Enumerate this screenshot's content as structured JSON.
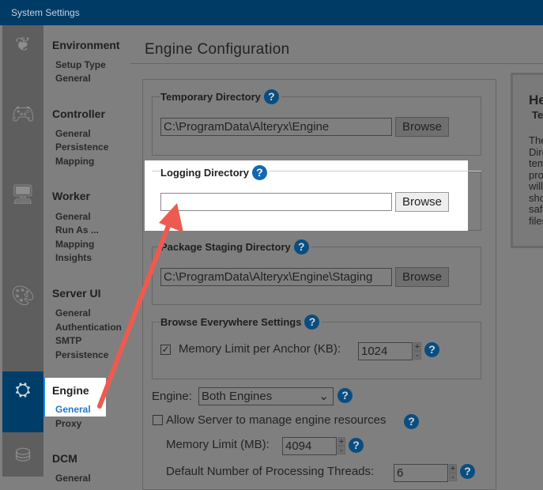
{
  "window": {
    "title": "System Settings"
  },
  "nav": {
    "sections": [
      {
        "title": "Environment",
        "items": [
          "Setup Type",
          "General"
        ]
      },
      {
        "title": "Controller",
        "items": [
          "General",
          "Persistence",
          "Mapping"
        ]
      },
      {
        "title": "Worker",
        "items": [
          "General",
          "Run As ...",
          "Mapping",
          "Insights"
        ]
      },
      {
        "title": "Server UI",
        "items": [
          "General",
          "Authentication",
          "SMTP",
          "Persistence"
        ]
      },
      {
        "title": "Engine",
        "items": [
          "General",
          "Proxy"
        ]
      },
      {
        "title": "DCM",
        "items": [
          "General"
        ]
      }
    ]
  },
  "main": {
    "title": "Engine Configuration",
    "temp_dir": {
      "label": "Temporary Directory",
      "value": "C:\\ProgramData\\Alteryx\\Engine",
      "browse": "Browse"
    },
    "log_dir": {
      "label": "Logging Directory",
      "value": "",
      "browse": "Browse"
    },
    "staging_dir": {
      "label": "Package Staging Directory",
      "value": "C:\\ProgramData\\Alteryx\\Engine\\Staging",
      "browse": "Browse"
    },
    "browse_everywhere": {
      "label": "Browse Everywhere Settings",
      "mem_label": "Memory Limit per Anchor (KB):",
      "mem_value": "1024",
      "checked": true
    },
    "engine": {
      "label": "Engine:",
      "value": "Both Engines"
    },
    "allow_manage": {
      "label": "Allow Server to manage engine resources",
      "checked": false
    },
    "mem_limit": {
      "label": "Memory Limit (MB):",
      "value": "4094"
    },
    "threads": {
      "label": "Default Number of Processing Threads:",
      "value": "6"
    }
  },
  "help": {
    "title": "He",
    "subtitle": "Te",
    "lines": [
      "The",
      "Dire",
      "tem",
      "pro",
      "will",
      "sho",
      "saf",
      "files"
    ]
  },
  "colors": {
    "titlebar": "#003b66",
    "accent": "#1268b3",
    "arrow": "#ee5a4f"
  }
}
